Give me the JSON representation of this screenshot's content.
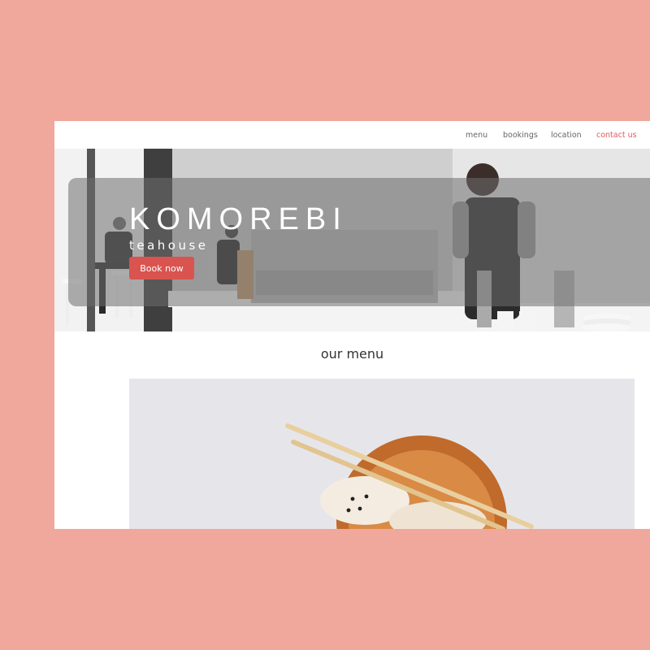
{
  "nav": {
    "links": [
      "menu",
      "bookings",
      "location",
      "contact us"
    ]
  },
  "hero": {
    "title": "KOMOREBI",
    "subtitle": "teahouse",
    "book_label": "Book now"
  },
  "menu_section": {
    "title": "our menu"
  },
  "colors": {
    "page_background": "#efa89b",
    "accent": "#d9534f",
    "contact_link": "#e05a5a"
  }
}
